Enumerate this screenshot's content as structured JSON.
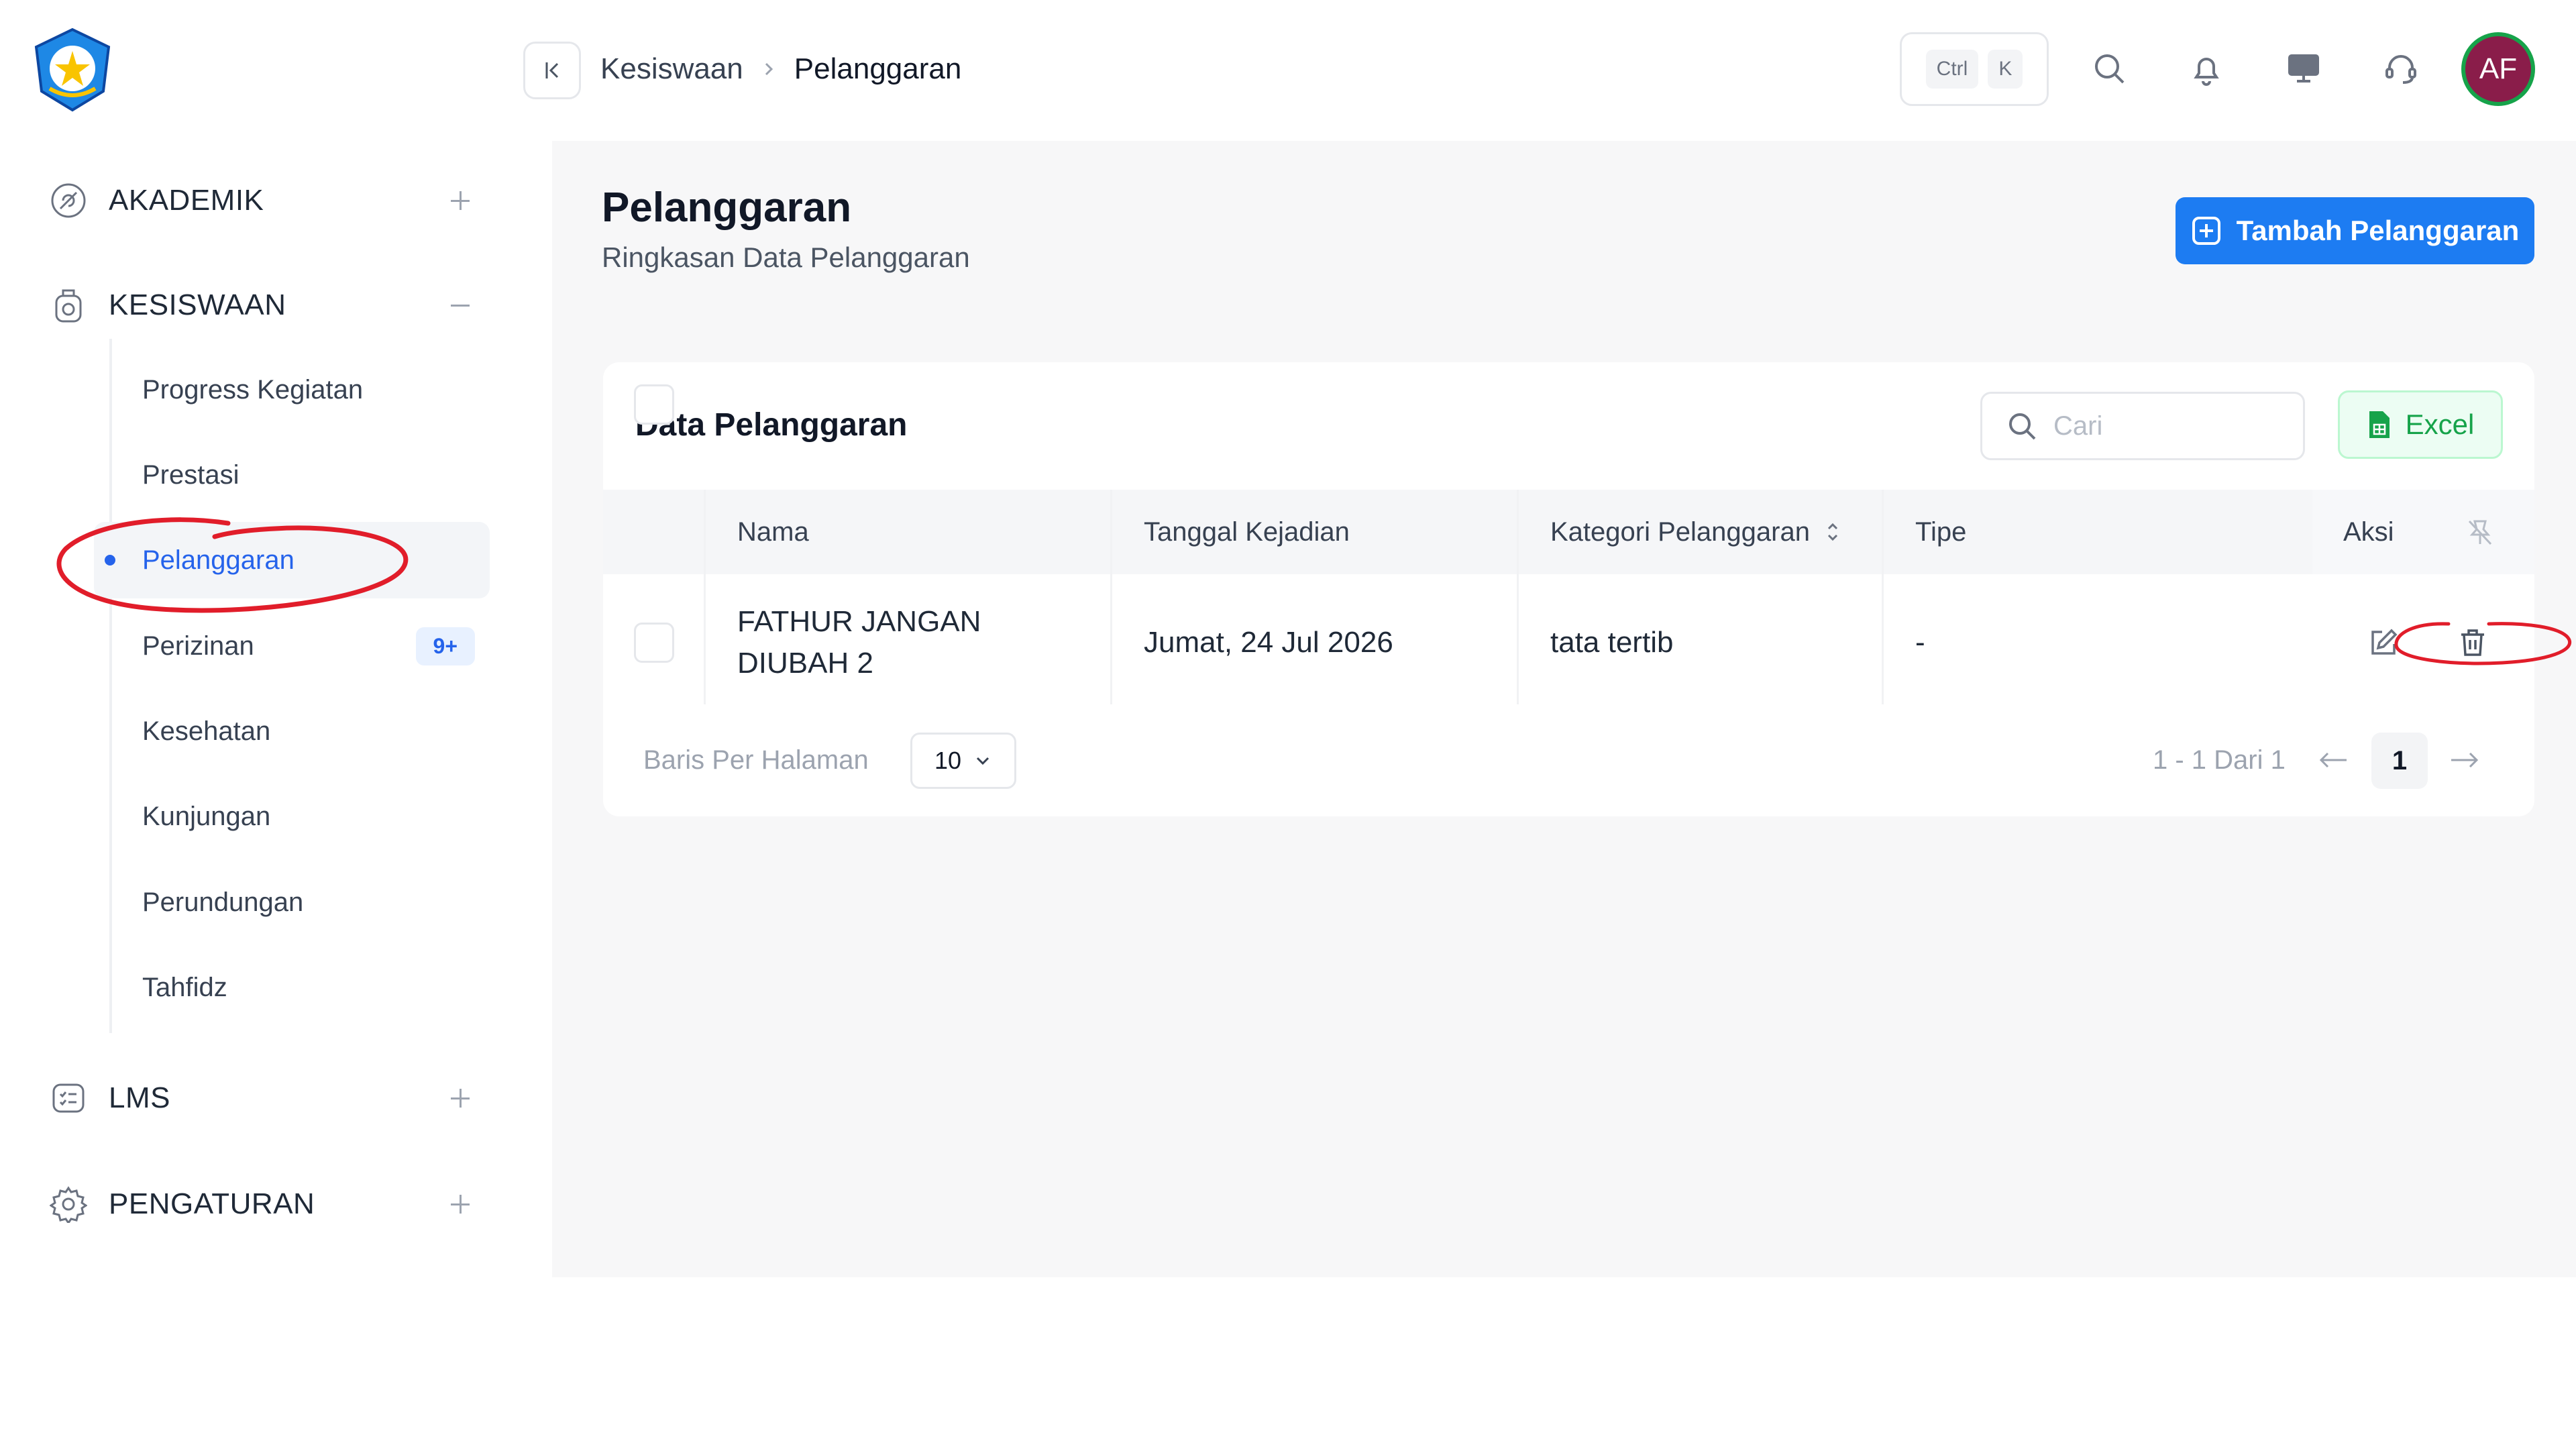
{
  "sidebar": {
    "groups": [
      {
        "label": "AKADEMIK",
        "icon": "academic-icon",
        "state": "collapsed"
      },
      {
        "label": "KESISWAAN",
        "icon": "student-icon",
        "state": "expanded"
      },
      {
        "label": "LMS",
        "icon": "lms-icon",
        "state": "collapsed"
      },
      {
        "label": "PENGATURAN",
        "icon": "gear-icon",
        "state": "collapsed"
      }
    ],
    "kesiswaan_items": [
      {
        "label": "Progress Kegiatan"
      },
      {
        "label": "Prestasi"
      },
      {
        "label": "Pelanggaran",
        "active": true
      },
      {
        "label": "Perizinan",
        "badge": "9+"
      },
      {
        "label": "Kesehatan"
      },
      {
        "label": "Kunjungan"
      },
      {
        "label": "Perundungan"
      },
      {
        "label": "Tahfidz"
      }
    ]
  },
  "topbar": {
    "breadcrumb": [
      "Kesiswaan",
      "Pelanggaran"
    ],
    "shortcut": [
      "Ctrl",
      "K"
    ],
    "avatar_initials": "AF",
    "avatar_color": "#8a1d4a",
    "avatar_ring_color": "#16a34a"
  },
  "page": {
    "title": "Pelanggaran",
    "subtitle": "Ringkasan Data Pelanggaran",
    "add_button": "Tambah Pelanggaran"
  },
  "card": {
    "title": "Data Pelanggaran",
    "search_placeholder": "Cari",
    "search_value": "",
    "excel_button": "Excel",
    "columns": [
      "Nama",
      "Tanggal Kejadian",
      "Kategori Pelanggaran",
      "Tipe",
      "Aksi"
    ],
    "rows": [
      {
        "nama_line1": "FATHUR JANGAN",
        "nama_line2": "DIUBAH 2",
        "tanggal": "Jumat, 24 Jul 2026",
        "kategori": "tata tertib",
        "tipe": "-"
      }
    ],
    "footer": {
      "rows_label": "Baris Per Halaman",
      "rows_value": "10",
      "page_info": "1 - 1 Dari 1",
      "current_page": "1"
    }
  },
  "colors": {
    "primary": "#1d7cf2",
    "active_link": "#2563eb",
    "excel_green": "#16a34a",
    "annotation_red": "#e11d2a"
  }
}
